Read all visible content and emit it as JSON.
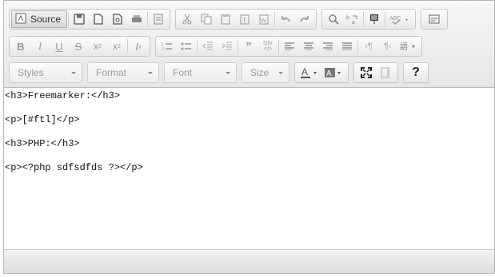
{
  "toolbar": {
    "source_label": "Source",
    "styles": {
      "placeholder": "Styles"
    },
    "format": {
      "placeholder": "Format"
    },
    "font": {
      "placeholder": "Font"
    },
    "size": {
      "placeholder": "Size"
    },
    "help_label": "?",
    "colors": {
      "accent": "#555555",
      "text": "#333333",
      "disabled": "#9a9a9a"
    }
  },
  "content": {
    "lines": [
      "<h3>Freemarker:</h3>",
      "<p>[#ftl]</p>",
      "<h3>PHP:</h3>",
      "<p><?php sdfsdfds ?></p>"
    ]
  }
}
